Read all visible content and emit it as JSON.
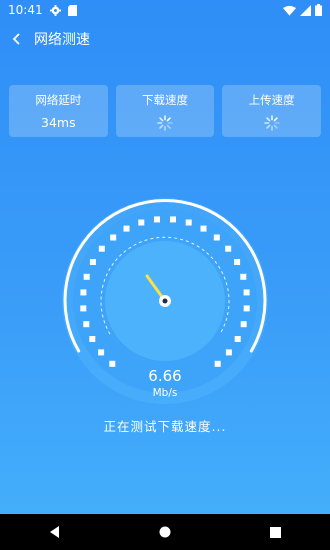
{
  "status_bar": {
    "time": "10:41"
  },
  "header": {
    "title": "网络测速"
  },
  "cards": [
    {
      "label": "网络延时",
      "value": "34ms",
      "state": "done"
    },
    {
      "label": "下载速度",
      "value": "",
      "state": "loading"
    },
    {
      "label": "上传速度",
      "value": "",
      "state": "loading"
    }
  ],
  "gauge": {
    "speed": "6.66",
    "unit": "Mb/s"
  },
  "status_text": "正在测试下载速度...",
  "colors": {
    "background": "#3a9df8",
    "needle": "#f7e04a",
    "nav": "#000000"
  }
}
